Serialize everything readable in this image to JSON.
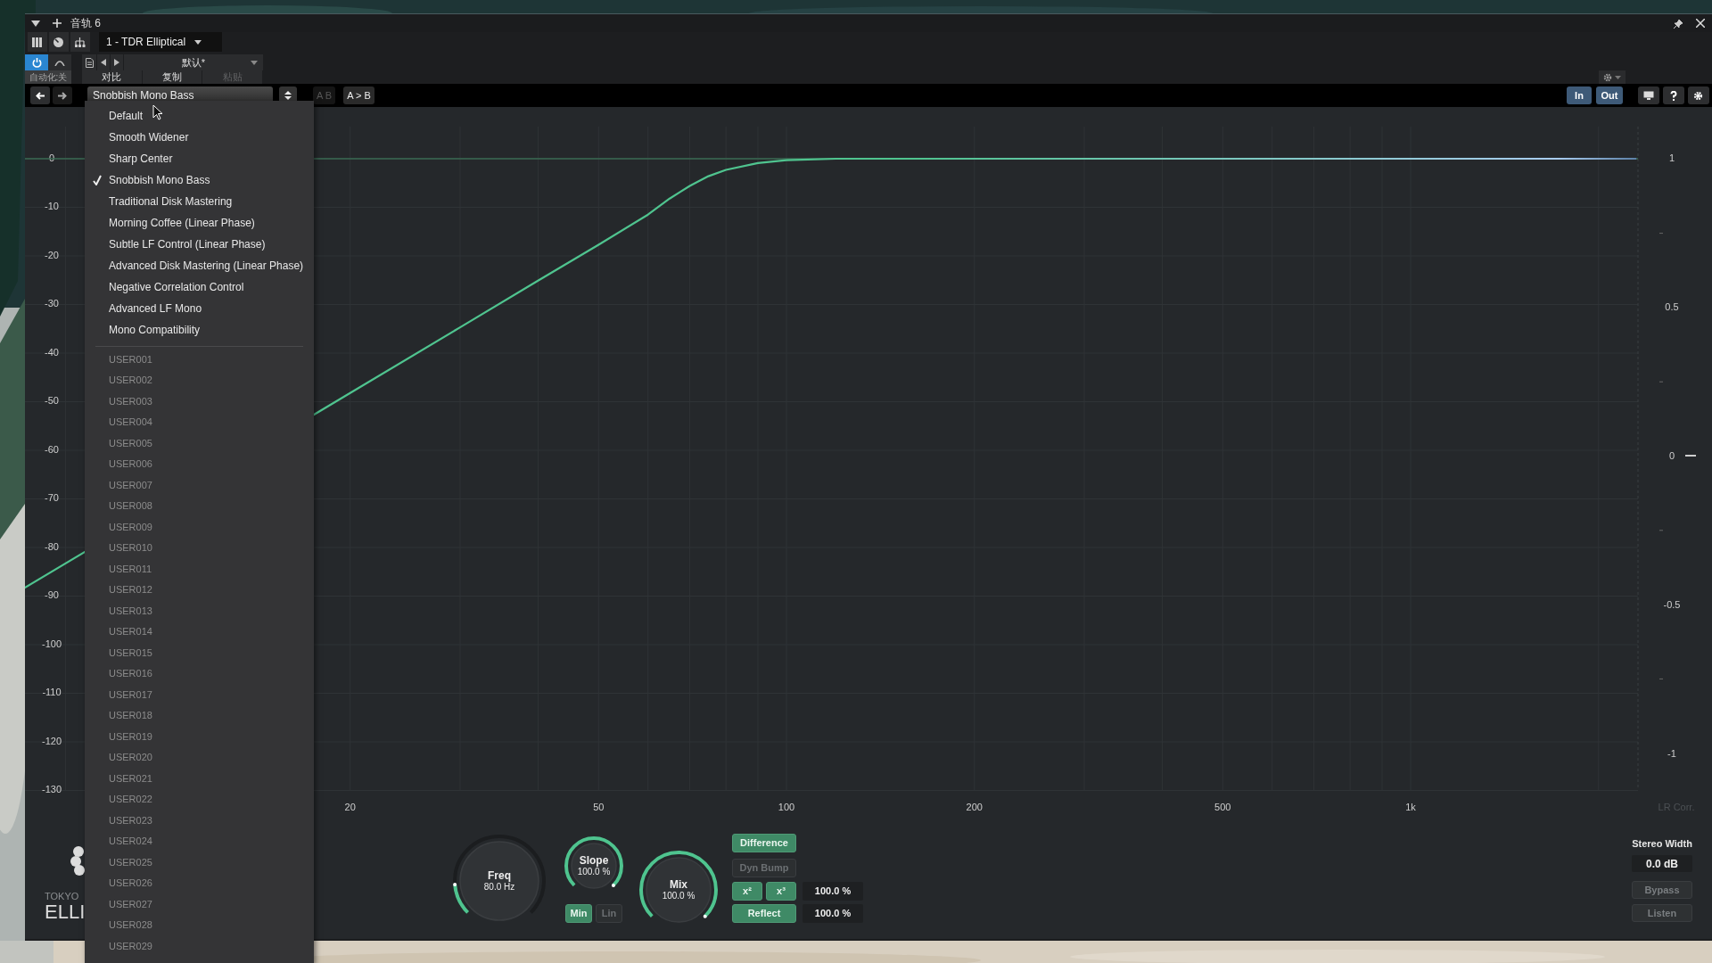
{
  "window": {
    "title": "音轨 6"
  },
  "plugin_selector": {
    "value": "1 - TDR Elliptical"
  },
  "preset_bar": {
    "power_on": true,
    "preset": "默认*",
    "automation": "自动化:关",
    "actions": [
      {
        "label": "对比",
        "disabled": false
      },
      {
        "label": "复制",
        "disabled": false
      },
      {
        "label": "粘贴",
        "disabled": true
      }
    ]
  },
  "plugin_toolbar": {
    "preset": "Snobbish Mono Bass",
    "compare": [
      {
        "label": "A B",
        "disabled": true
      },
      {
        "label": "A > B",
        "disabled": false
      }
    ],
    "monitor": [
      {
        "label": "In",
        "selected": true
      },
      {
        "label": "Out",
        "selected": true
      }
    ]
  },
  "preset_menu": {
    "factory": [
      {
        "label": "Default",
        "checked": false
      },
      {
        "label": "Smooth Widener",
        "checked": false
      },
      {
        "label": "Sharp Center",
        "checked": false
      },
      {
        "label": "Snobbish Mono Bass",
        "checked": true
      },
      {
        "label": "Traditional Disk Mastering",
        "checked": false
      },
      {
        "label": "Morning Coffee (Linear Phase)",
        "checked": false
      },
      {
        "label": "Subtle LF Control (Linear Phase)",
        "checked": false
      },
      {
        "label": "Advanced Disk Mastering (Linear Phase)",
        "checked": false
      },
      {
        "label": "Negative Correlation Control",
        "checked": false
      },
      {
        "label": "Advanced LF Mono",
        "checked": false
      },
      {
        "label": "Mono Compatibility",
        "checked": false
      }
    ],
    "user": [
      "USER001",
      "USER002",
      "USER003",
      "USER004",
      "USER005",
      "USER006",
      "USER007",
      "USER008",
      "USER009",
      "USER010",
      "USER011",
      "USER012",
      "USER013",
      "USER014",
      "USER015",
      "USER016",
      "USER017",
      "USER018",
      "USER019",
      "USER020",
      "USER021",
      "USER022",
      "USER023",
      "USER024",
      "USER025",
      "USER026",
      "USER027",
      "USER028",
      "USER029"
    ]
  },
  "graph": {
    "db_labels": [
      "0",
      "-10",
      "-20",
      "-30",
      "-40",
      "-50",
      "-60",
      "-70",
      "-80",
      "-90",
      "-100",
      "-110",
      "-120",
      "-130"
    ],
    "freq_labels": [
      "20",
      "50",
      "100",
      "200",
      "500",
      "1k"
    ],
    "corr_ticks": [
      "1",
      "0.5",
      "0",
      "-0.5",
      "-1"
    ],
    "corr_title": "LR Corr."
  },
  "controls": {
    "knobs": [
      {
        "label": "Freq",
        "value": "80.0 Hz"
      },
      {
        "label": "Slope",
        "value": "100.0 %"
      },
      {
        "label": "Mix",
        "value": "100.0 %"
      }
    ],
    "phase": [
      {
        "label": "Min",
        "selected": true
      },
      {
        "label": "Lin",
        "selected": false
      }
    ],
    "toggles": [
      {
        "label": "Difference",
        "on": true
      },
      {
        "label": "Dyn Bump",
        "on": false
      }
    ],
    "harmonics": [
      {
        "label": "x²",
        "on": true
      },
      {
        "label": "x³",
        "on": true
      }
    ],
    "reflect": {
      "label": "Reflect",
      "on": true
    },
    "amounts": [
      "100.0 %",
      "100.0 %"
    ]
  },
  "side": {
    "title": "Stereo Width",
    "value": "0.0 dB",
    "buttons": [
      {
        "label": "Bypass",
        "on": false
      },
      {
        "label": "Listen",
        "on": false
      }
    ]
  },
  "logo": {
    "line1": "TOKYO",
    "line2": "ELLI"
  }
}
